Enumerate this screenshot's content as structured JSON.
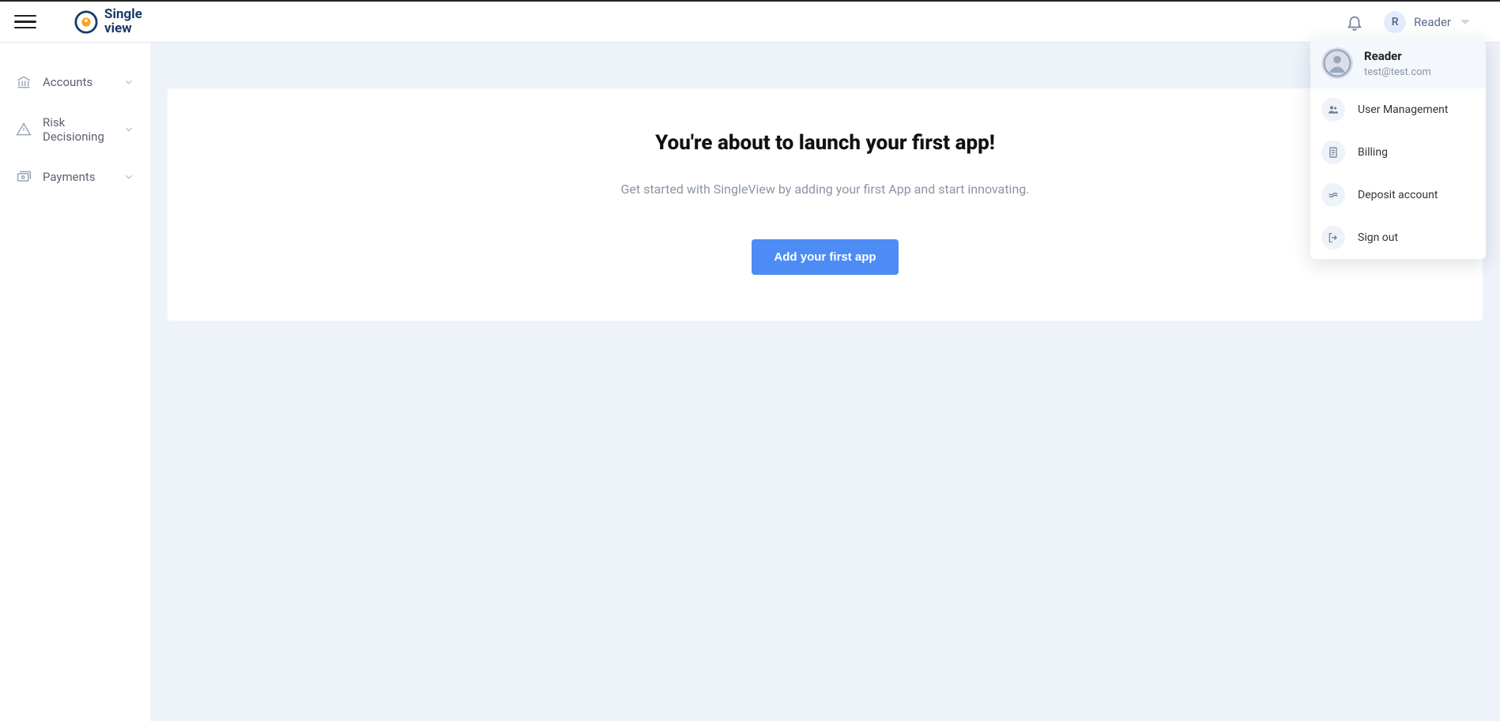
{
  "brand": {
    "line1": "Single",
    "line2": "view"
  },
  "header": {
    "user_initial": "R",
    "user_name": "Reader"
  },
  "sidebar": {
    "items": [
      {
        "label": "Accounts"
      },
      {
        "label": "Risk Decisioning"
      },
      {
        "label": "Payments"
      }
    ]
  },
  "main": {
    "title": "You're about to launch your first app!",
    "subtitle": "Get started with SingleView by adding your first App and start innovating.",
    "cta": "Add your first app"
  },
  "dropdown": {
    "name": "Reader",
    "email": "test@test.com",
    "items": [
      {
        "label": "User Management"
      },
      {
        "label": "Billing"
      },
      {
        "label": "Deposit account"
      },
      {
        "label": "Sign out"
      }
    ]
  }
}
